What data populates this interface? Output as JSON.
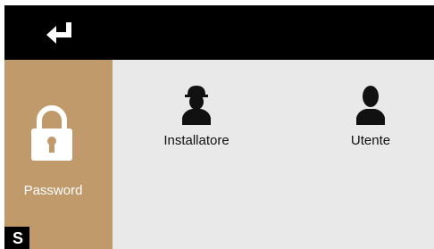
{
  "colors": {
    "topbar": "#000000",
    "sidebar": "#c19a6b",
    "content": "#e9e9e9"
  },
  "topbar": {
    "back_icon": "return-arrow-icon"
  },
  "sidebar": {
    "password_label": "Password",
    "icon": "padlock-icon"
  },
  "users": [
    {
      "label": "Installatore",
      "icon": "installer-person-icon"
    },
    {
      "label": "Utente",
      "icon": "user-person-icon"
    }
  ],
  "corner": {
    "glyph": "S"
  }
}
